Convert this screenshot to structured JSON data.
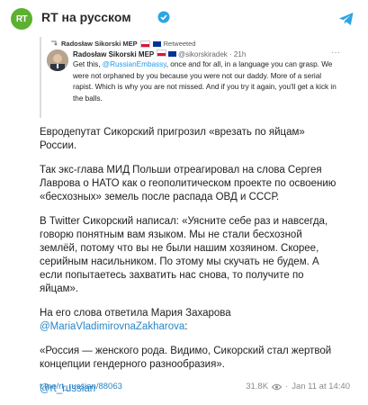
{
  "channel": {
    "name": "RT на русском",
    "logo_text": "RT"
  },
  "retweet": {
    "retweeted_by": "Radosław Sikorski MEP",
    "retweeted_label": "Retweeted",
    "author_name": "Radosław Sikorski MEP",
    "author_handle": "@sikorskiradek",
    "time": "21h",
    "text_part1": "Get this, ",
    "mention": "@RussianEmbassy",
    "text_part2": ", once and for all, in a language you can grasp. We were not orphaned by you because you were not our daddy. More of a serial rapist. Which is why you are not missed. And if you try it again, you'll get a kick in the balls."
  },
  "post": {
    "p1": "Евродепутат Сикорский пригрозил «врезать по яйцам» России.",
    "p2": "Так экс-глава МИД Польши отреагировал на слова Сергея Лаврова о НАТО как о геополитическом проекте по освоению «бесхозных» земель после распада ОВД и СССР.",
    "p3": "В Twitter Сикорский написал: «Уясните себе раз и навсегда, говорю понятным вам языком. Мы не стали бесхозной землёй, потому что вы не были нашим хозяином. Скорее, серийным насильником. По этому мы скучать не будем. А если попытаетесь захватить нас снова, то получите по яйцам».",
    "p4_text": "На его слова ответила Мария Захарова",
    "p4_mention": "@MariaVladimirovnaZakharova",
    "p4_colon": ":",
    "p5": "«Россия — женского рода. Видимо, Сикорский стал жертвой концепции гендерного разнообразия».",
    "signature": "@rt_russian"
  },
  "footer": {
    "link": "t.me/rt_russian/88063",
    "views": "31.8K",
    "date": "Jan 11 at 14:40"
  },
  "colors": {
    "rt_green": "#5cb130",
    "link_blue": "#2a84c4",
    "telegram_blue": "#2ca5e0"
  }
}
